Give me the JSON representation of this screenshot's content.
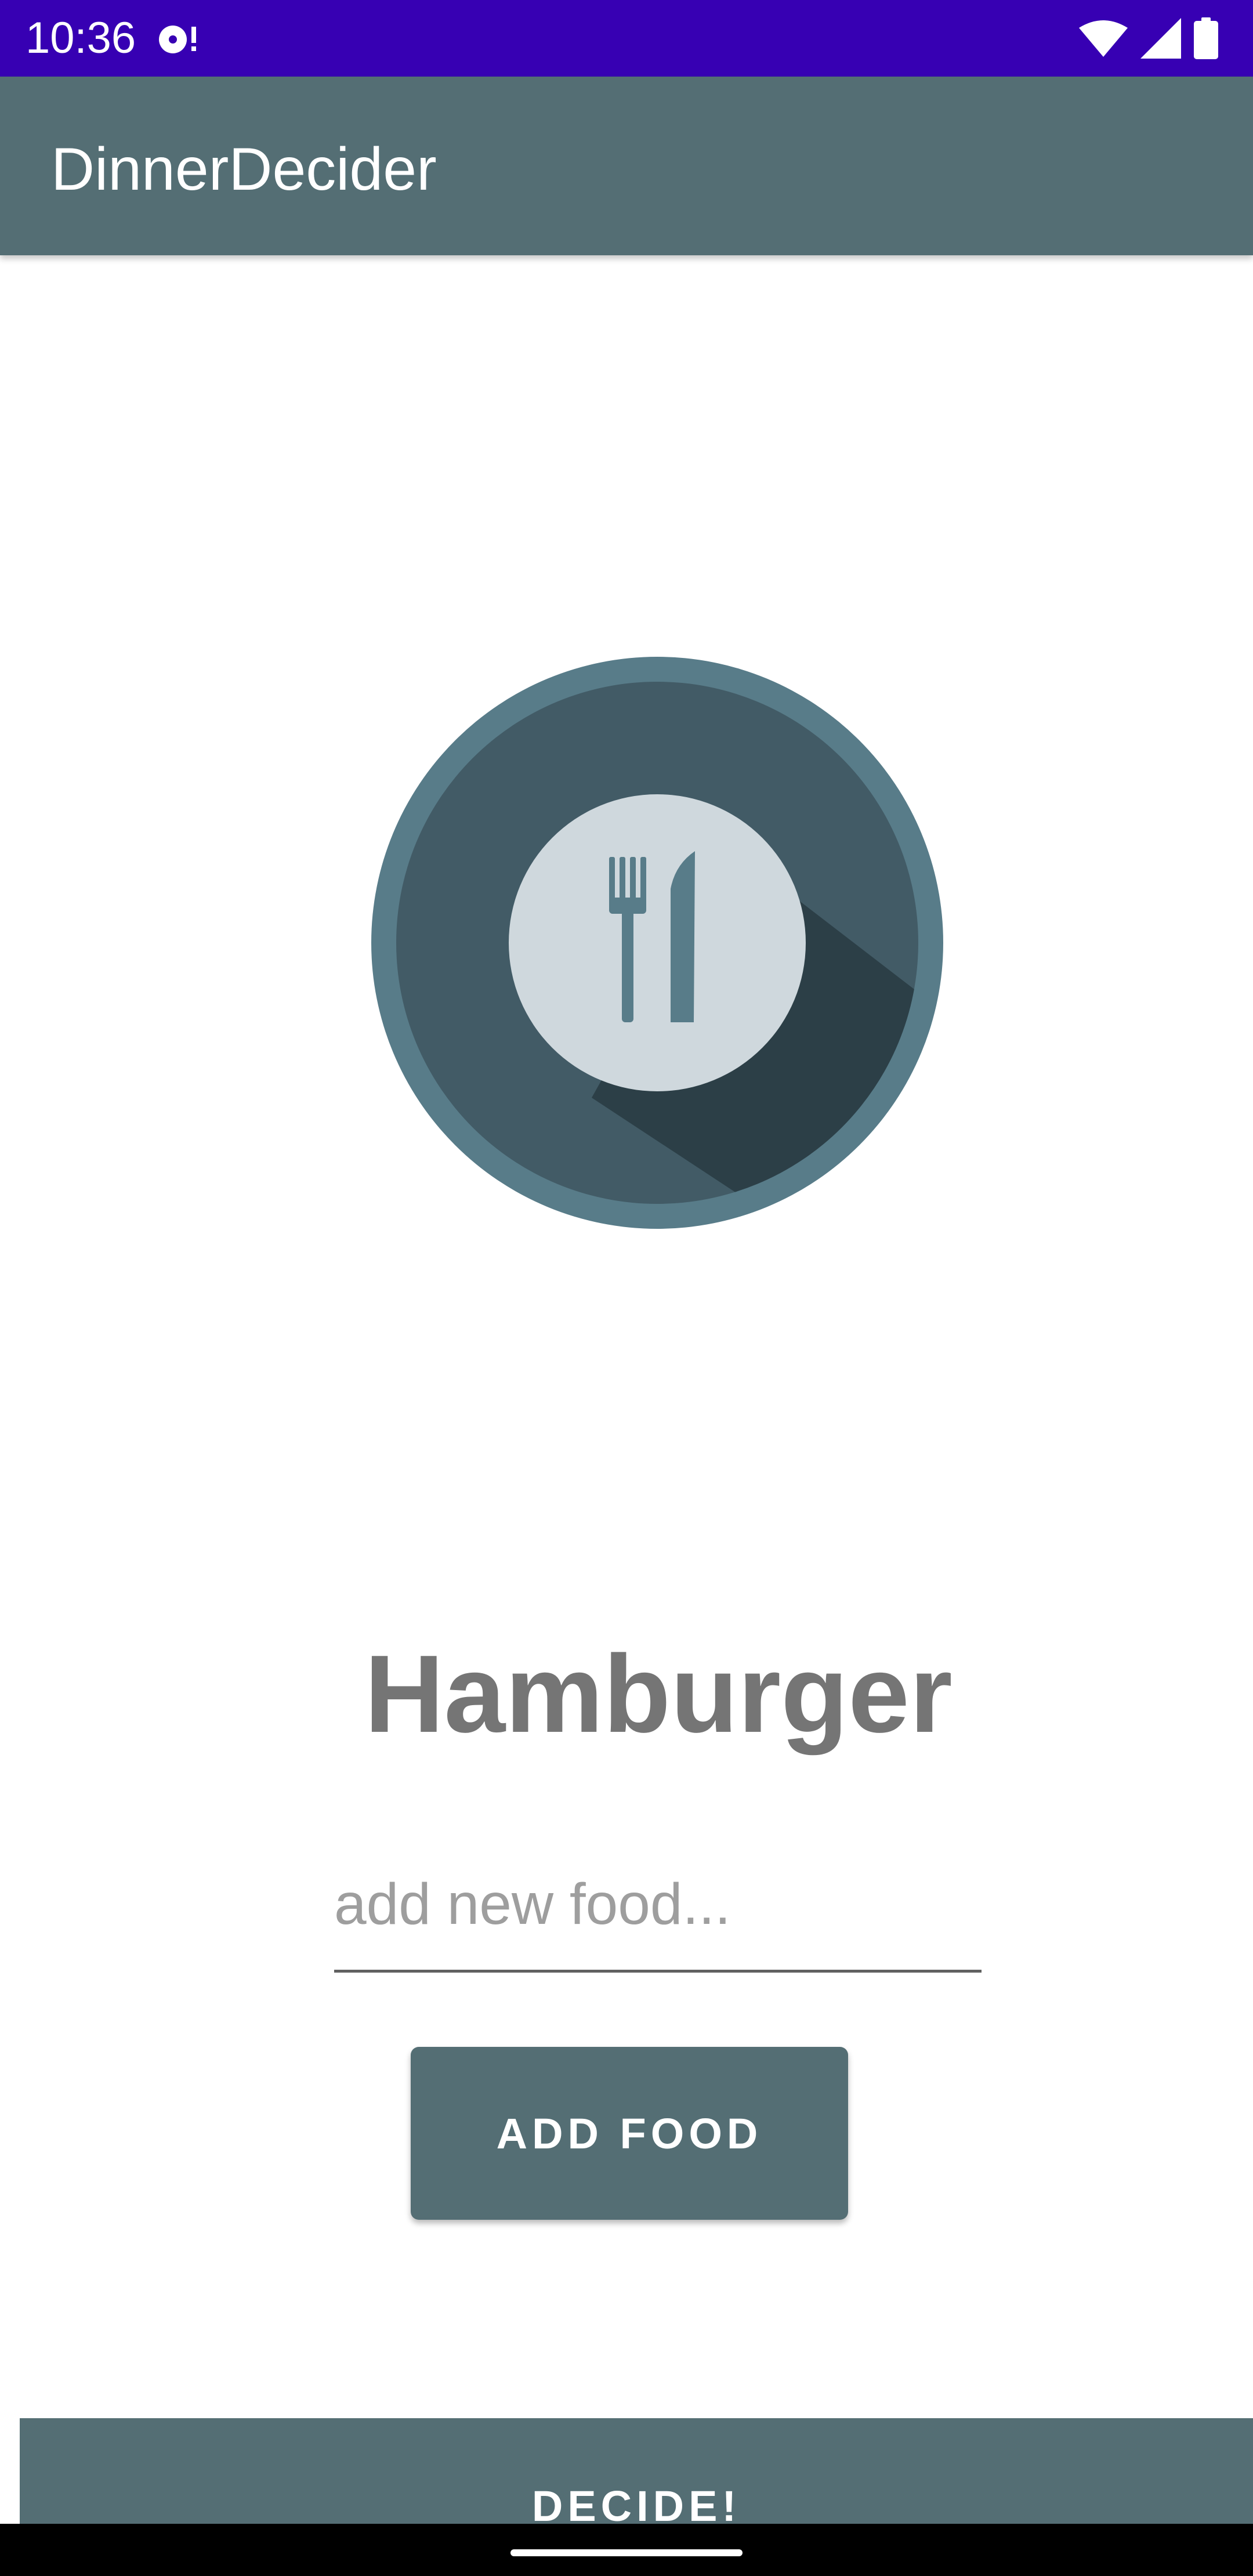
{
  "status_bar": {
    "time": "10:36",
    "color": "#3700b3",
    "icons": [
      "media-notification-icon",
      "wifi-icon",
      "signal-icon",
      "battery-icon"
    ]
  },
  "app_bar": {
    "title": "DinnerDecider",
    "color": "#546e74"
  },
  "logo": {
    "icon": "plate-fork-knife-icon"
  },
  "main": {
    "selected_food": "Hamburger",
    "new_food_input": {
      "value": "",
      "placeholder": "add new food..."
    },
    "add_food_label": "ADD FOOD",
    "decide_label": "DECIDE!"
  }
}
